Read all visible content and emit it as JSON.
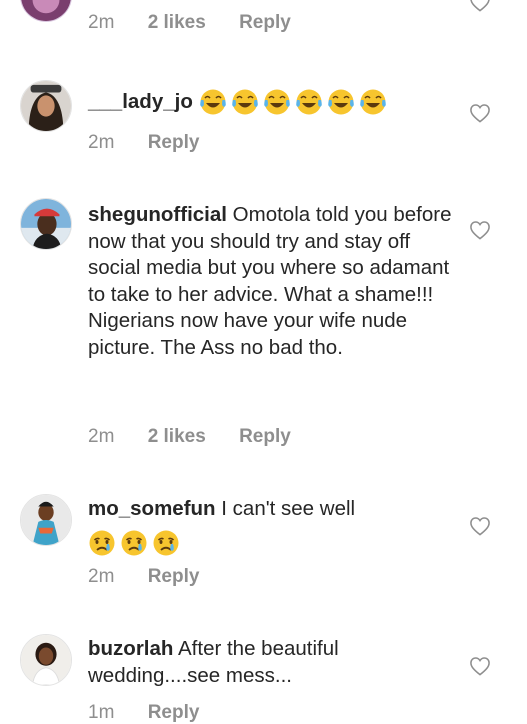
{
  "comments": [
    {
      "username": "",
      "text": "",
      "time": "2m",
      "likes": "2 likes",
      "reply": "Reply"
    },
    {
      "username": "___lady_jo",
      "text": "",
      "emojis": [
        "face-with-tears-of-joy",
        "face-with-tears-of-joy",
        "face-with-tears-of-joy",
        "face-with-tears-of-joy",
        "face-with-tears-of-joy",
        "face-with-tears-of-joy"
      ],
      "time": "2m",
      "reply": "Reply"
    },
    {
      "username": "shegunofficial",
      "text": "Omotola told you before now that you should try and stay off social media but you where so adamant to take to her advice. What a shame!!! Nigerians now have your wife nude picture. The Ass no bad tho.",
      "time": "2m",
      "likes": "2 likes",
      "reply": "Reply"
    },
    {
      "username": "mo_somefun",
      "text": "I can't see well",
      "emojis": [
        "crying-face",
        "crying-face",
        "crying-face"
      ],
      "time": "2m",
      "reply": "Reply"
    },
    {
      "username": "buzorlah",
      "text": "After the beautiful wedding....see mess...",
      "time": "1m",
      "reply": "Reply"
    }
  ],
  "colors": {
    "text": "#262626",
    "meta": "#8e8e8e",
    "heart": "#8e8e8e",
    "emoji_face": "#f7c52e"
  }
}
